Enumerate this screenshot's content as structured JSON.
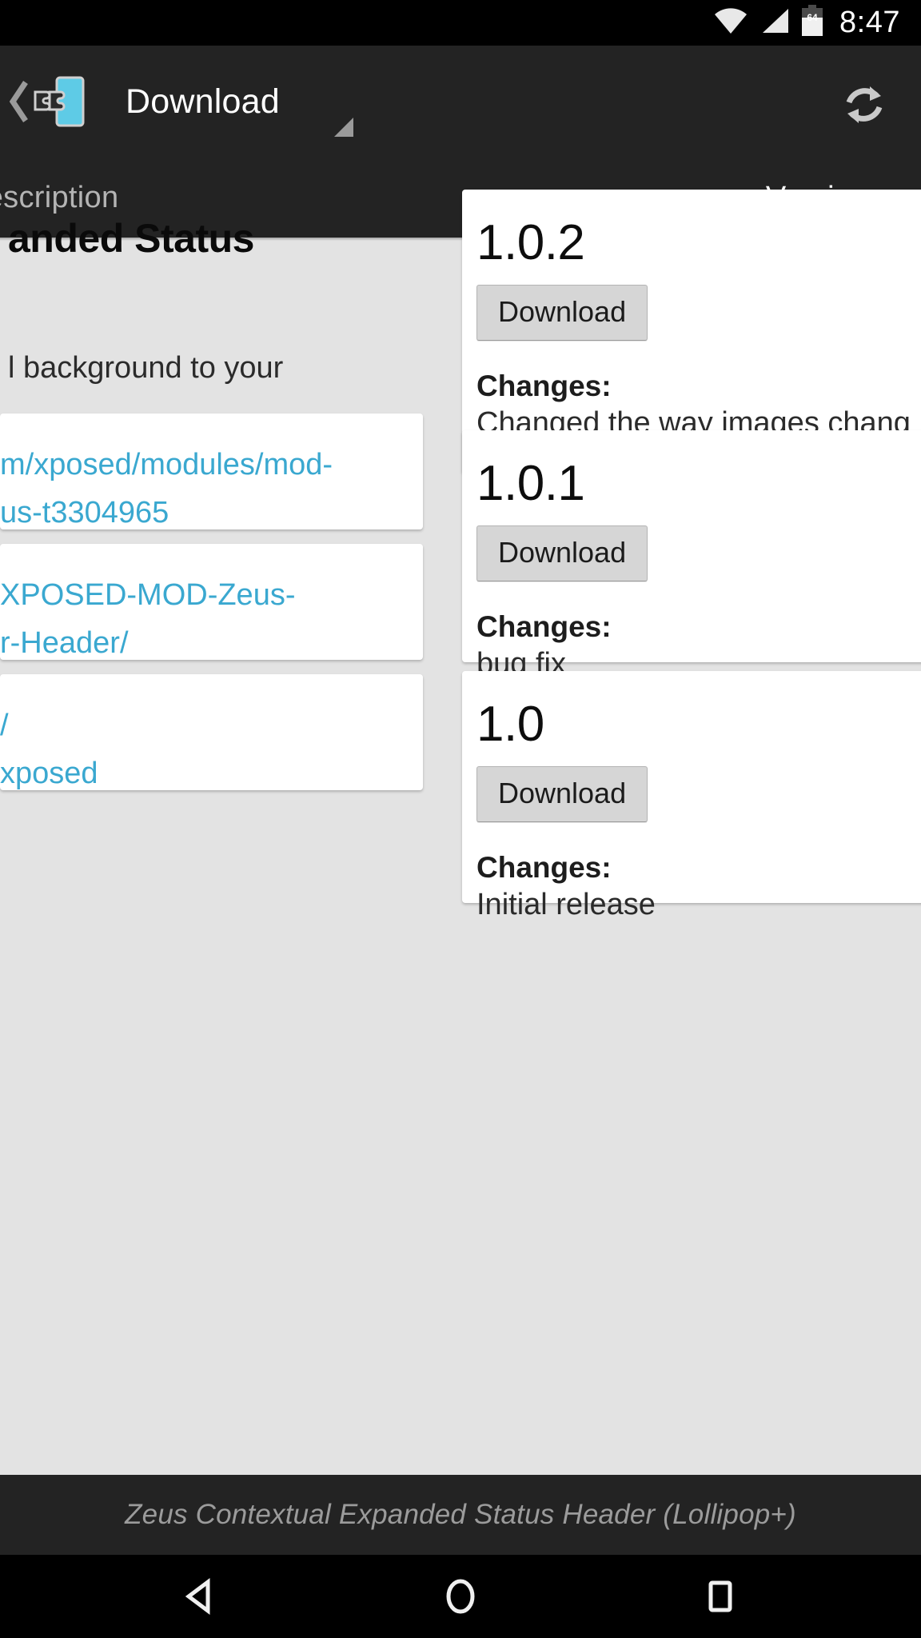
{
  "status_bar": {
    "wifi_icon": "wifi-icon",
    "signal_icon": "cell-signal-icon",
    "battery_icon": "battery-icon",
    "battery_level": "64",
    "time": "8:47"
  },
  "action_bar": {
    "back_icon": "back-chevron-icon",
    "app_icon": "xposed-module-icon",
    "title": "Download",
    "spinner_caret_icon": "dropdown-caret-icon",
    "refresh_icon": "refresh-icon"
  },
  "tabs": {
    "items": [
      {
        "label": "Description",
        "active": false
      },
      {
        "label": "Versions",
        "active": true
      }
    ],
    "active_index": 1
  },
  "description_pane": {
    "title": "anded Status",
    "body": "l background to your",
    "link_cards": [
      {
        "lines": [
          "m/xposed/modules/mod-",
          "us-t3304965"
        ]
      },
      {
        "lines": [
          "XPOSED-MOD-Zeus-",
          "r-Header/"
        ]
      },
      {
        "lines": [
          "/",
          "xposed"
        ]
      }
    ]
  },
  "versions_pane": {
    "changes_label": "Changes:",
    "download_label": "Download",
    "versions": [
      {
        "version": "1.0.2",
        "changes": "Changed the way images chang"
      },
      {
        "version": "1.0.1",
        "changes": "bug fix"
      },
      {
        "version": "1.0",
        "changes": "Initial release"
      }
    ]
  },
  "footer": {
    "text": "Zeus Contextual Expanded Status Header (Lollipop+)"
  },
  "nav_bar": {
    "back_icon": "nav-back-icon",
    "home_icon": "nav-home-icon",
    "recents_icon": "nav-recents-icon"
  },
  "colors": {
    "accent_link": "#3aa8d0",
    "chrome_dark": "#232323",
    "page_background": "#e3e3e3",
    "icon_cyan": "#5ecbe6"
  }
}
